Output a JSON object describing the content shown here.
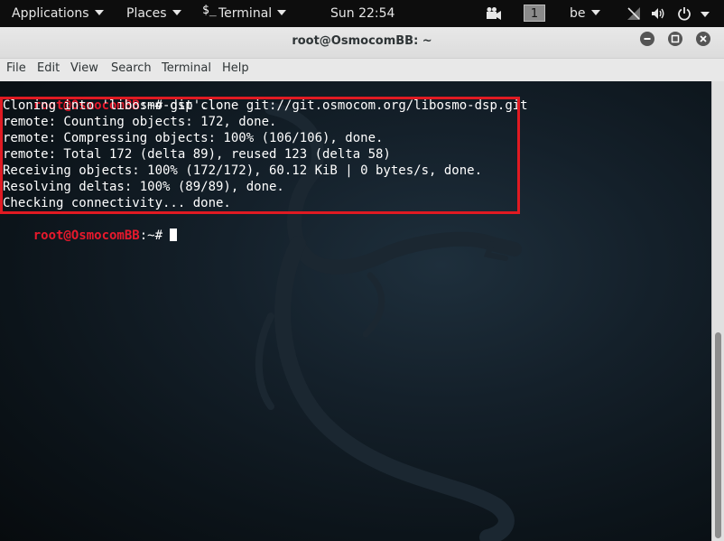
{
  "topbar": {
    "applications": "Applications",
    "places": "Places",
    "terminal_glyph": "$_",
    "terminal": "Terminal",
    "clock": "Sun 22:54",
    "workspace": "1",
    "keyboard_layout": "be",
    "icons": [
      "screencast-icon",
      "network-icon",
      "volume-icon",
      "power-icon"
    ]
  },
  "window": {
    "title": "root@OsmocomBB: ~",
    "buttons": [
      "minimize",
      "maximize",
      "close"
    ]
  },
  "menubar": [
    "File",
    "Edit",
    "View",
    "Search",
    "Terminal",
    "Help"
  ],
  "terminal": {
    "prompt_user": "root@OsmocomBB",
    "prompt_suffix": ":~# ",
    "command": "git clone git://git.osmocom.org/libosmo-dsp.git",
    "output": [
      "Cloning into 'libosmo-dsp'...",
      "remote: Counting objects: 172, done.",
      "remote: Compressing objects: 100% (106/106), done.",
      "remote: Total 172 (delta 89), reused 123 (delta 58)",
      "Receiving objects: 100% (172/172), 60.12 KiB | 0 bytes/s, done.",
      "Resolving deltas: 100% (89/89), done.",
      "Checking connectivity... done."
    ],
    "prompt2_user": "root@OsmocomBB",
    "prompt2_suffix": ":~# "
  },
  "colors": {
    "prompt_user": "#e8192c",
    "highlight_border": "#e01a22",
    "terminal_text": "#ffffff",
    "topbar_bg": "#0d0d0d"
  }
}
